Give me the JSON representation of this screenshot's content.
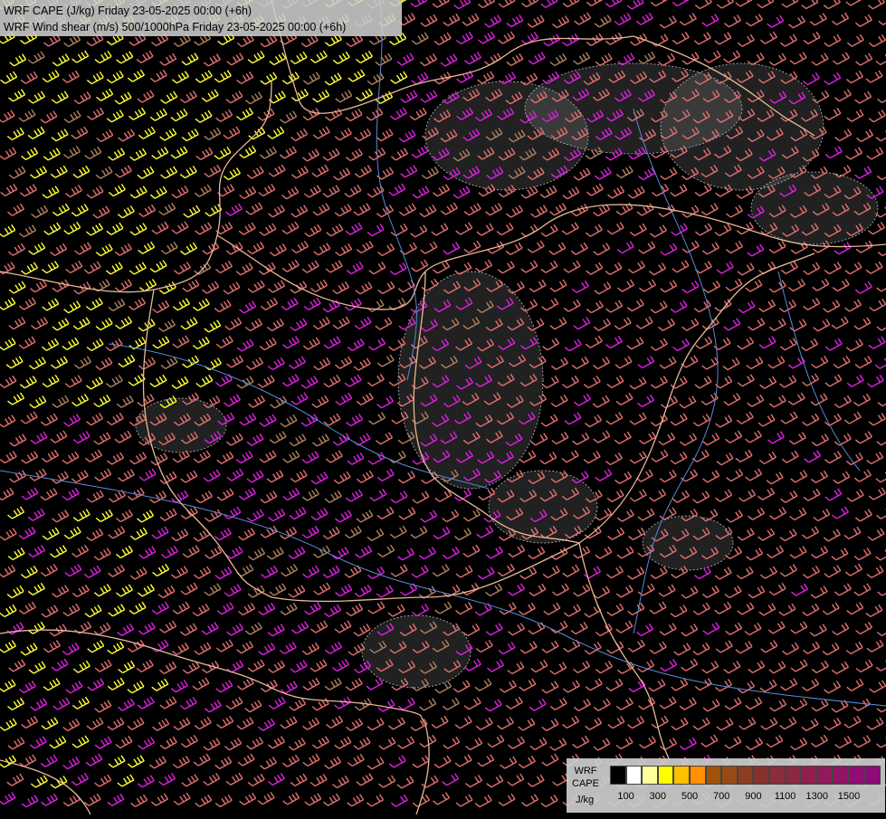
{
  "header": {
    "line1": "WRF CAPE (J/kg) Friday 23-05-2025 00:00 (+6h)",
    "line2": "WRF Wind shear (m/s) 500/1000hPa Friday 23-05-2025 00:00 (+6h)"
  },
  "legend": {
    "model": "WRF",
    "field": "CAPE",
    "unit": "J/kg",
    "colors": [
      "#000000",
      "#ffffff",
      "#ffff99",
      "#ffff00",
      "#ffc000",
      "#ff9000",
      "#a0520a",
      "#984a14",
      "#8e3c22",
      "#86322c",
      "#8a2e3a",
      "#8c2840",
      "#901f4e",
      "#921a5a",
      "#921466",
      "#900e72",
      "#8c0a7a"
    ],
    "ticks": [
      "100",
      "300",
      "500",
      "700",
      "900",
      "1100",
      "1300",
      "1500"
    ]
  },
  "map_colors": {
    "background": "#000000",
    "shear_low": "#ffff33",
    "shear_mid": "#e27070",
    "shear_high": "#e020e0",
    "shear_mix": "#b08060",
    "borders": "#e8b898",
    "rivers": "#5a8ad8",
    "cape_contours": "#c0c0c0"
  }
}
